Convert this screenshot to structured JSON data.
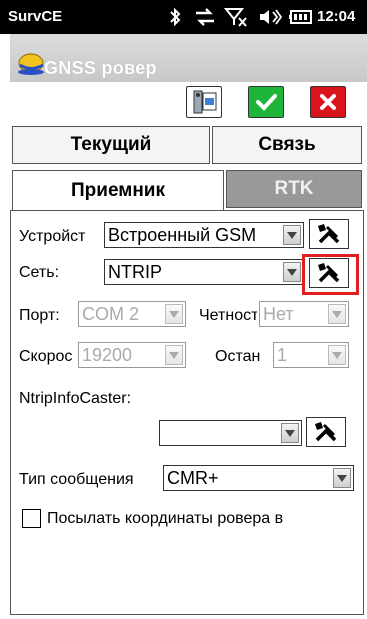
{
  "status_bar": {
    "app_name": "SurvCE",
    "time": "12:04",
    "icons": [
      "bluetooth-icon",
      "data-sync-icon",
      "signal-off-icon",
      "volume-icon",
      "battery-icon"
    ]
  },
  "window": {
    "title": "GNSS ровер",
    "icon": "survce-helmet-icon"
  },
  "toolbar": {
    "buttons": [
      "config-tool-icon",
      "ok-check-icon",
      "cancel-x-icon"
    ]
  },
  "tabs": {
    "current": "Текущий",
    "link": "Связь",
    "receiver": "Приемник",
    "rtk": "RTK",
    "active": "receiver"
  },
  "form": {
    "device_label": "Устройст",
    "device_value": "Встроенный GSM",
    "network_label": "Сеть:",
    "network_value": "NTRIP",
    "port_label": "Порт:",
    "port_value": "COM 2",
    "parity_label": "Четност",
    "parity_value": "Нет",
    "speed_label": "Скорос",
    "speed_value": "19200",
    "stop_label": "Останс",
    "stop_value": "1",
    "ntrip_label": "NtripInfoCaster:",
    "ntrip_value": "",
    "msg_type_label": "Тип сообщения",
    "msg_type_value": "CMR+",
    "send_coords_label": "Посылать координаты ровера в",
    "send_coords_checked": false
  },
  "colors": {
    "ok_green": "#1db53a",
    "cancel_red": "#d9151b",
    "highlight_red": "#e02020",
    "rtk_tab_gray": "#999999"
  }
}
